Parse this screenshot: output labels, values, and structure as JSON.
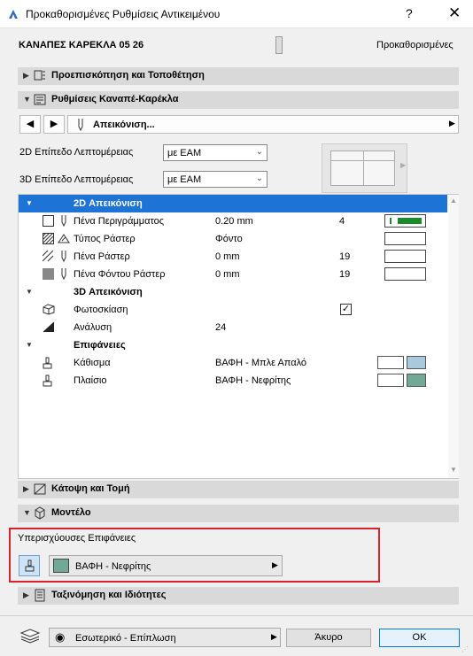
{
  "window": {
    "title": "Προκαθορισμένες Ρυθμίσεις Αντικειμένου",
    "help": "?",
    "close": "✕"
  },
  "header": {
    "object_name": "ΚΑΝΑΠΕΣ ΚΑΡΕΚΛΑ 05 26",
    "preset": "Προκαθορισμένες"
  },
  "panels": {
    "preview": "Προεπισκόπηση και Τοποθέτηση",
    "settings": "Ρυθμίσεις Καναπέ-Καρέκλα",
    "floorplan": "Κάτοψη και Τομή",
    "model": "Μοντέλο",
    "classification": "Ταξινόμηση και Ιδιότητες"
  },
  "nav": {
    "prev": "◀",
    "next": "▶",
    "page_label": "Απεικόνιση...",
    "more": "▶"
  },
  "detail": {
    "label_2d": "2D Επίπεδο Λεπτομέρειας",
    "value_2d": "με ΕΑΜ",
    "label_3d": "3D Επίπεδο Λεπτομέρειας",
    "value_3d": "με ΕΑΜ"
  },
  "table": {
    "group_2d": "2D Απεικόνιση",
    "rows_2d": [
      {
        "name": "Πένα Περιγράμματος",
        "value": "0.20 mm",
        "num": "4"
      },
      {
        "name": "Τύπος Ράστερ",
        "value": "Φόντο",
        "num": ""
      },
      {
        "name": "Πένα Ράστερ",
        "value": "0 mm",
        "num": "19"
      },
      {
        "name": "Πένα Φόντου Ράστερ",
        "value": "0 mm",
        "num": "19"
      }
    ],
    "group_3d": "3D Απεικόνιση",
    "shading": {
      "name": "Φωτοσκίαση",
      "check": "✓"
    },
    "resolution": {
      "name": "Ανάλυση",
      "value": "24"
    },
    "group_surfaces": "Επιφάνειες",
    "surfaces": [
      {
        "name": "Κάθισμα",
        "value": "ΒΑΦΗ - Μπλε Απαλό",
        "color": "#a9c9dc"
      },
      {
        "name": "Πλαίσιο",
        "value": "ΒΑΦΗ - Νεφρίτης",
        "color": "#72a896"
      }
    ]
  },
  "override": {
    "label": "Υπερισχύουσες Επιφάνειες",
    "value": "ΒΑΦΗ - Νεφρίτης",
    "color": "#72a896",
    "arrow": "▶"
  },
  "footer": {
    "layer": "Εσωτερικό - Επίπλωση",
    "cancel": "Άκυρο",
    "ok": "OK"
  },
  "colors": {
    "selection": "#1e73d6",
    "pen_green": "#1a8a2a",
    "highlight": "#d8232a"
  }
}
